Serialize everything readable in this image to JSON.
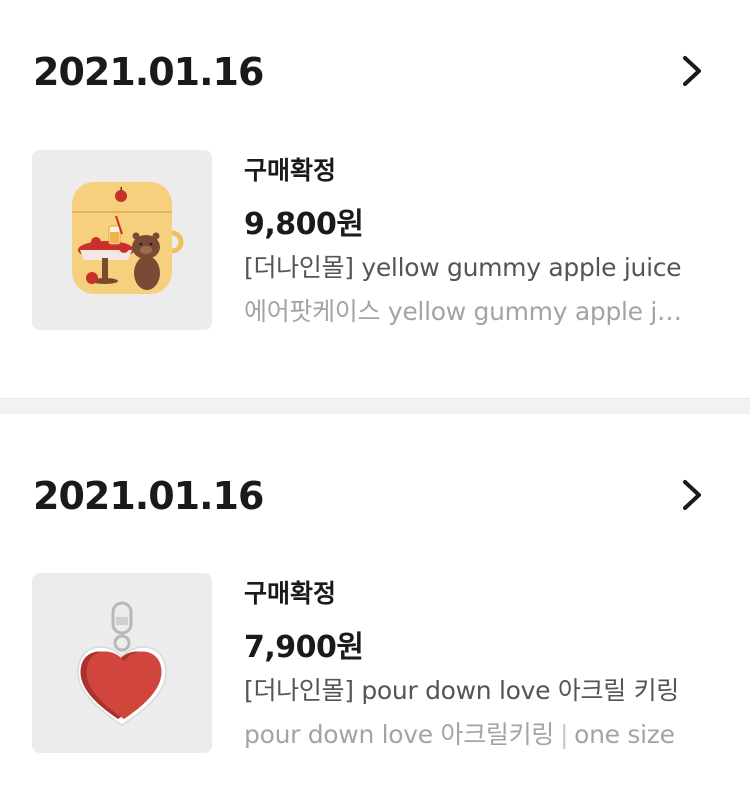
{
  "orders": [
    {
      "date": "2021.01.16",
      "status": "구매확정",
      "price": "9,800원",
      "title": "[더나인몰] yellow gummy apple juice",
      "option": "에어팟케이스 yellow gummy apple juice"
    },
    {
      "date": "2021.01.16",
      "status": "구매확정",
      "price": "7,900원",
      "title": "[더나인몰] pour down love 아크릴 키링",
      "option_name": "pour down love 아크릴키링",
      "option_separator": "|",
      "option_size": "one size"
    }
  ],
  "icons": {
    "detail": "chevron-right-icon"
  },
  "colors": {
    "airpod_case": "#f6d07d",
    "heart": "#d0463d",
    "thumb_bg": "#eeeeee",
    "separator": "#f2f2f2"
  }
}
